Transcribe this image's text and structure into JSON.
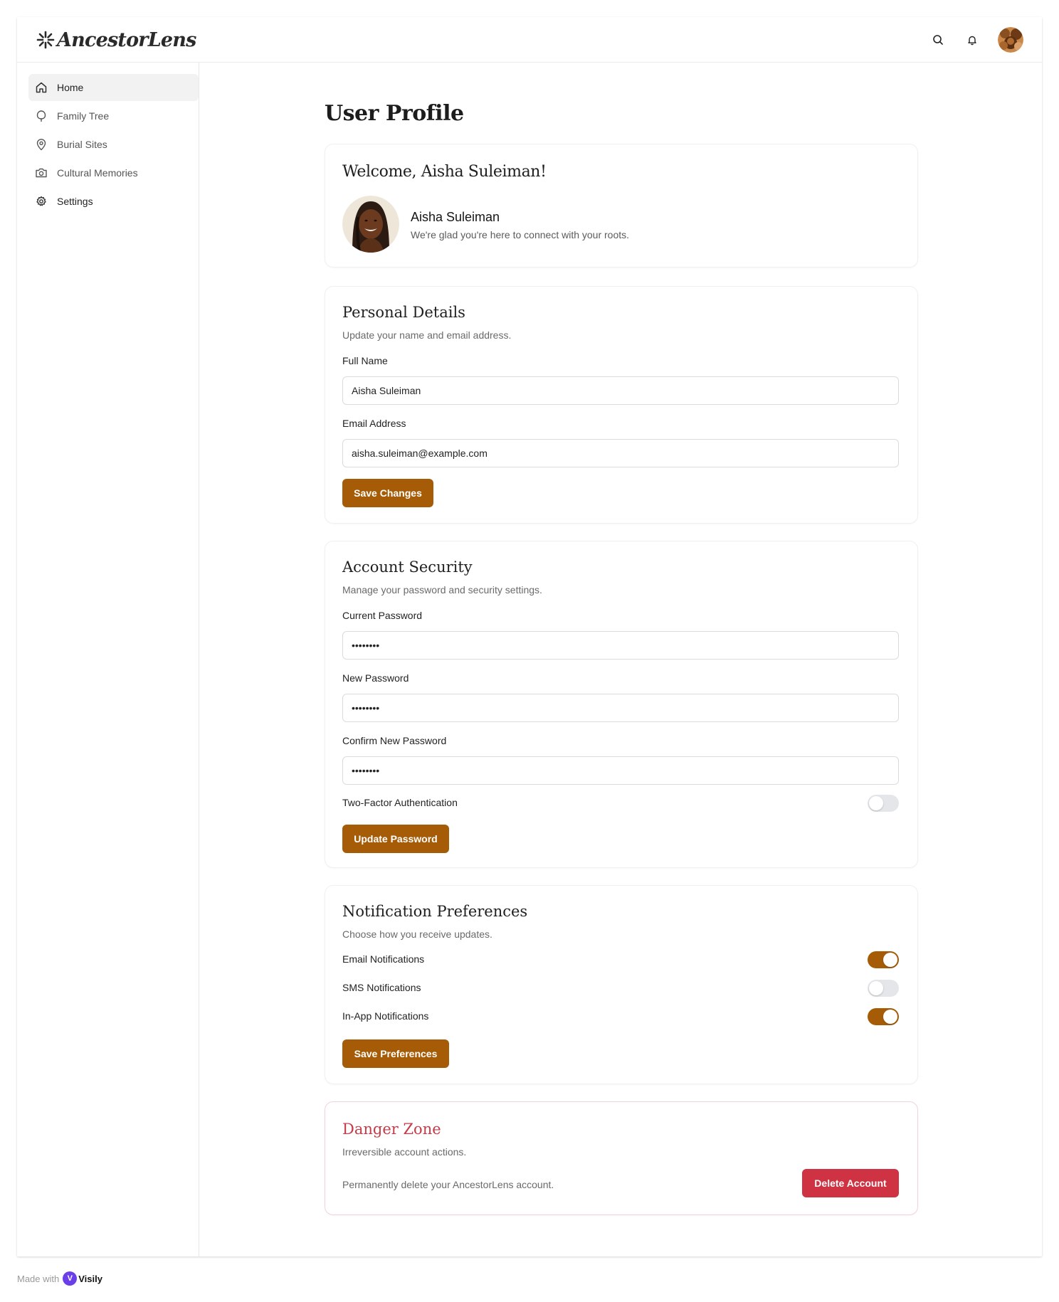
{
  "app": {
    "name": "AncestorLens"
  },
  "header": {
    "search_icon": "search-icon",
    "bell_icon": "bell-icon"
  },
  "sidebar": {
    "items": [
      {
        "label": "Home",
        "icon": "home-icon",
        "active": true
      },
      {
        "label": "Family Tree",
        "icon": "tree-icon",
        "active": false
      },
      {
        "label": "Burial Sites",
        "icon": "map-pin-icon",
        "active": false
      },
      {
        "label": "Cultural Memories",
        "icon": "camera-icon",
        "active": false
      },
      {
        "label": "Settings",
        "icon": "gear-icon",
        "active": false
      }
    ]
  },
  "page": {
    "title": "User Profile"
  },
  "welcome": {
    "title": "Welcome, Aisha Suleiman!",
    "name": "Aisha Suleiman",
    "message": "We're glad you're here to connect with your roots."
  },
  "personal": {
    "title": "Personal Details",
    "subtitle": "Update your name and email address.",
    "full_name_label": "Full Name",
    "full_name_value": "Aisha Suleiman",
    "email_label": "Email Address",
    "email_value": "aisha.suleiman@example.com",
    "save_label": "Save Changes"
  },
  "security": {
    "title": "Account Security",
    "subtitle": "Manage your password and security settings.",
    "current_label": "Current Password",
    "current_value": "••••••••",
    "new_label": "New Password",
    "new_value": "••••••••",
    "confirm_label": "Confirm New Password",
    "confirm_value": "••••••••",
    "twofa_label": "Two-Factor Authentication",
    "twofa_enabled": false,
    "update_label": "Update Password"
  },
  "notifications": {
    "title": "Notification Preferences",
    "subtitle": "Choose how you receive updates.",
    "items": [
      {
        "label": "Email Notifications",
        "enabled": true
      },
      {
        "label": "SMS Notifications",
        "enabled": false
      },
      {
        "label": "In-App Notifications",
        "enabled": true
      }
    ],
    "save_label": "Save Preferences"
  },
  "danger": {
    "title": "Danger Zone",
    "subtitle": "Irreversible account actions.",
    "description": "Permanently delete your AncestorLens account.",
    "delete_label": "Delete Account"
  },
  "footer": {
    "made_with": "Made with",
    "brand": "Visily"
  },
  "colors": {
    "accent": "#a65c06",
    "danger": "#cf3343",
    "danger_title": "#c73a48"
  }
}
